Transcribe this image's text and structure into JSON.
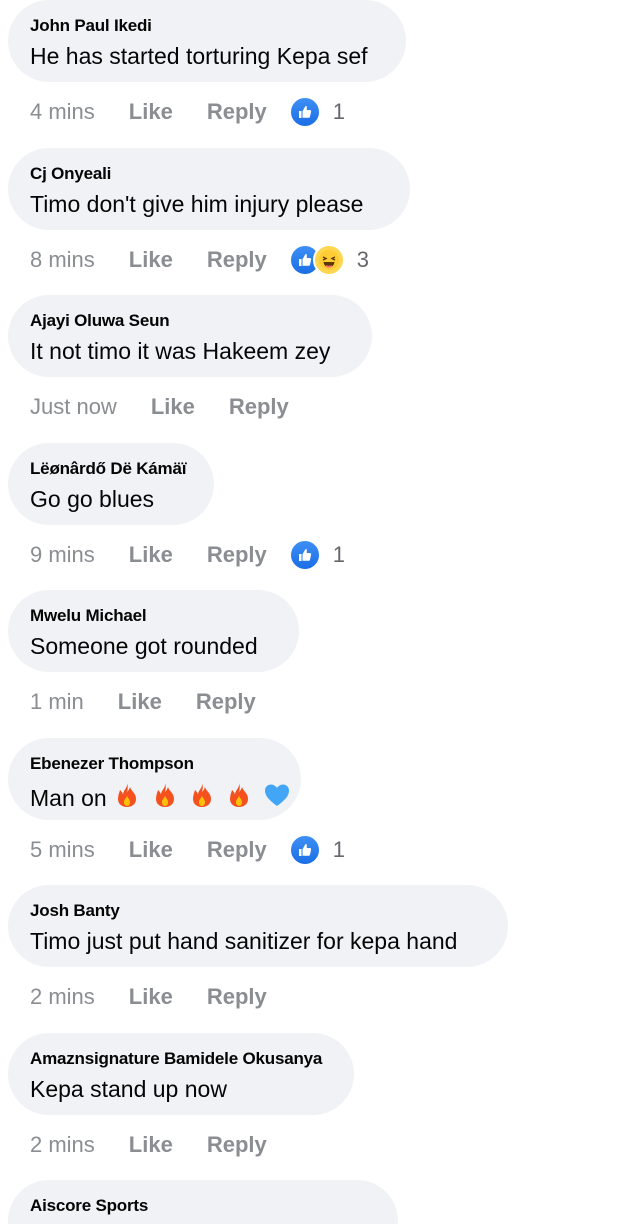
{
  "actions": {
    "like": "Like",
    "reply": "Reply"
  },
  "colors": {
    "bubble": "#f0f2f5",
    "meta": "#8a8d91",
    "like_blue": "#1b6ee6"
  },
  "comments": [
    {
      "author": "John Paul Ikedi",
      "text": "He has started torturing Kepa sef",
      "time": "4 mins",
      "reactions": [
        "like"
      ],
      "count": "1"
    },
    {
      "author": "Cj Onyeali",
      "text": "Timo don't give him injury please",
      "time": "8 mins",
      "reactions": [
        "like",
        "haha"
      ],
      "count": "3"
    },
    {
      "author": "Ajayi Oluwa Seun",
      "text": "It not timo it was Hakeem zey",
      "time": "Just now",
      "reactions": [],
      "count": ""
    },
    {
      "author": "Lëønârdő Dë Kámäï",
      "text": "Go go blues",
      "time": "9 mins",
      "reactions": [
        "like"
      ],
      "count": "1"
    },
    {
      "author": "Mwelu Michael",
      "text": "Someone got rounded",
      "time": "1 min",
      "reactions": [],
      "count": ""
    },
    {
      "author": "Ebenezer Thompson",
      "text": "Man on",
      "time": "5 mins",
      "reactions": [
        "like"
      ],
      "count": "1",
      "emojis": [
        "fire",
        "fire",
        "fire",
        "fire",
        "blue-heart"
      ]
    },
    {
      "author": "Josh Banty",
      "text": "Timo just put hand sanitizer for kepa hand",
      "time": "2 mins",
      "reactions": [],
      "count": ""
    },
    {
      "author": "Amaznsignature Bamidele Okusanya",
      "text": "Kepa stand up now",
      "time": "2 mins",
      "reactions": [],
      "count": ""
    },
    {
      "author": "Aiscore Sports",
      "text": "",
      "time": "",
      "reactions": [],
      "count": ""
    }
  ]
}
